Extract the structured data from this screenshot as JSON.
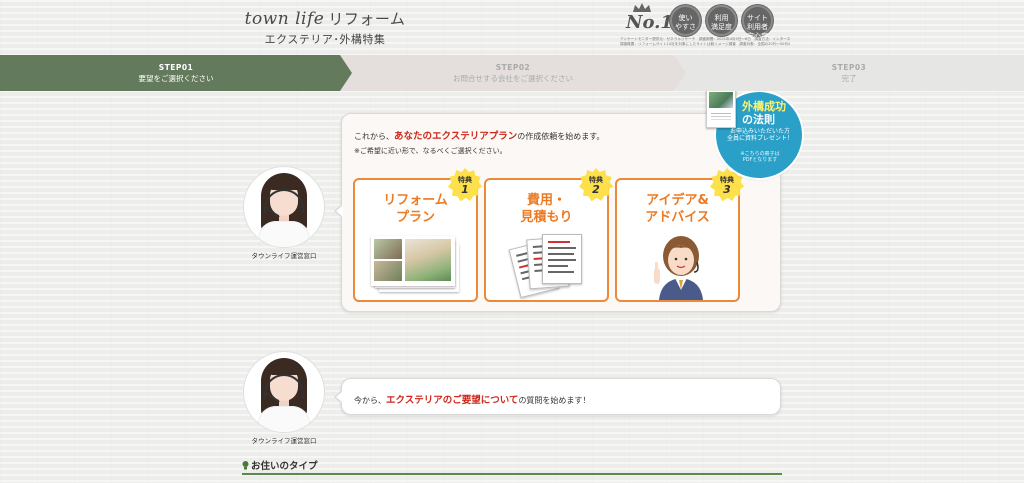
{
  "header": {
    "brand": "town life",
    "brand_jp": "リフォーム",
    "subtitle": "エクステリア･外構特集",
    "award_no1": "No.1",
    "badges": [
      "使い\nやすさ",
      "利用\n満足度",
      "サイト利用者\n安心度"
    ],
    "award_fine_1": "アンケートモニター提供元：ゼネラルリサーチ　調査期間：2021年4月5日～6日　調査方法：インターネット調査",
    "award_fine_2": "調査概要：リフォームサイト10社を対象にしたサイト比較イメージ調査　調査対象：全国の20代～50代の男女1009名"
  },
  "steps": [
    {
      "num": "STEP01",
      "label": "要望をご選択ください",
      "active": true
    },
    {
      "num": "STEP02",
      "label": "お問合せする会社をご選択ください",
      "active": false
    },
    {
      "num": "STEP03",
      "label": "完了",
      "active": false
    }
  ],
  "operator": {
    "label": "タウンライフ運営窓口"
  },
  "bubble1": {
    "intro_prefix": "これから、",
    "intro_highlight": "あなたのエクステリアプラン",
    "intro_suffix": "の作成依頼を始めます。",
    "note": "※ご希望に近い形で、なるべくご選択ください。"
  },
  "cards": [
    {
      "title": "リフォーム\nプラン",
      "badge": "特典",
      "badge_num": "1",
      "icon": "plan-photos-icon"
    },
    {
      "title": "費用・\n見積もり",
      "badge": "特典",
      "badge_num": "2",
      "icon": "estimate-documents-icon"
    },
    {
      "title": "アイデア&\nアドバイス",
      "badge": "特典",
      "badge_num": "3",
      "icon": "advisor-person-icon"
    }
  ],
  "promo": {
    "title_line1": "外構成功",
    "title_line2": "の法則",
    "text": "お申込みいただいた方\n全員に資料プレゼント！",
    "small": "※こちらの冊子は\nPDFとなります"
  },
  "bubble2": {
    "prefix": "今から、",
    "highlight": "エクステリアのご要望について",
    "suffix": "の質問を始めます！"
  },
  "section": {
    "title": "お住いのタイプ"
  },
  "colors": {
    "step_active": "#647a5c",
    "accent_orange": "#ec8a3b",
    "highlight_red": "#d0261a",
    "promo_blue": "#2aa0c8",
    "badge_yellow": "#fde04a",
    "section_line": "#5a8a4a"
  }
}
